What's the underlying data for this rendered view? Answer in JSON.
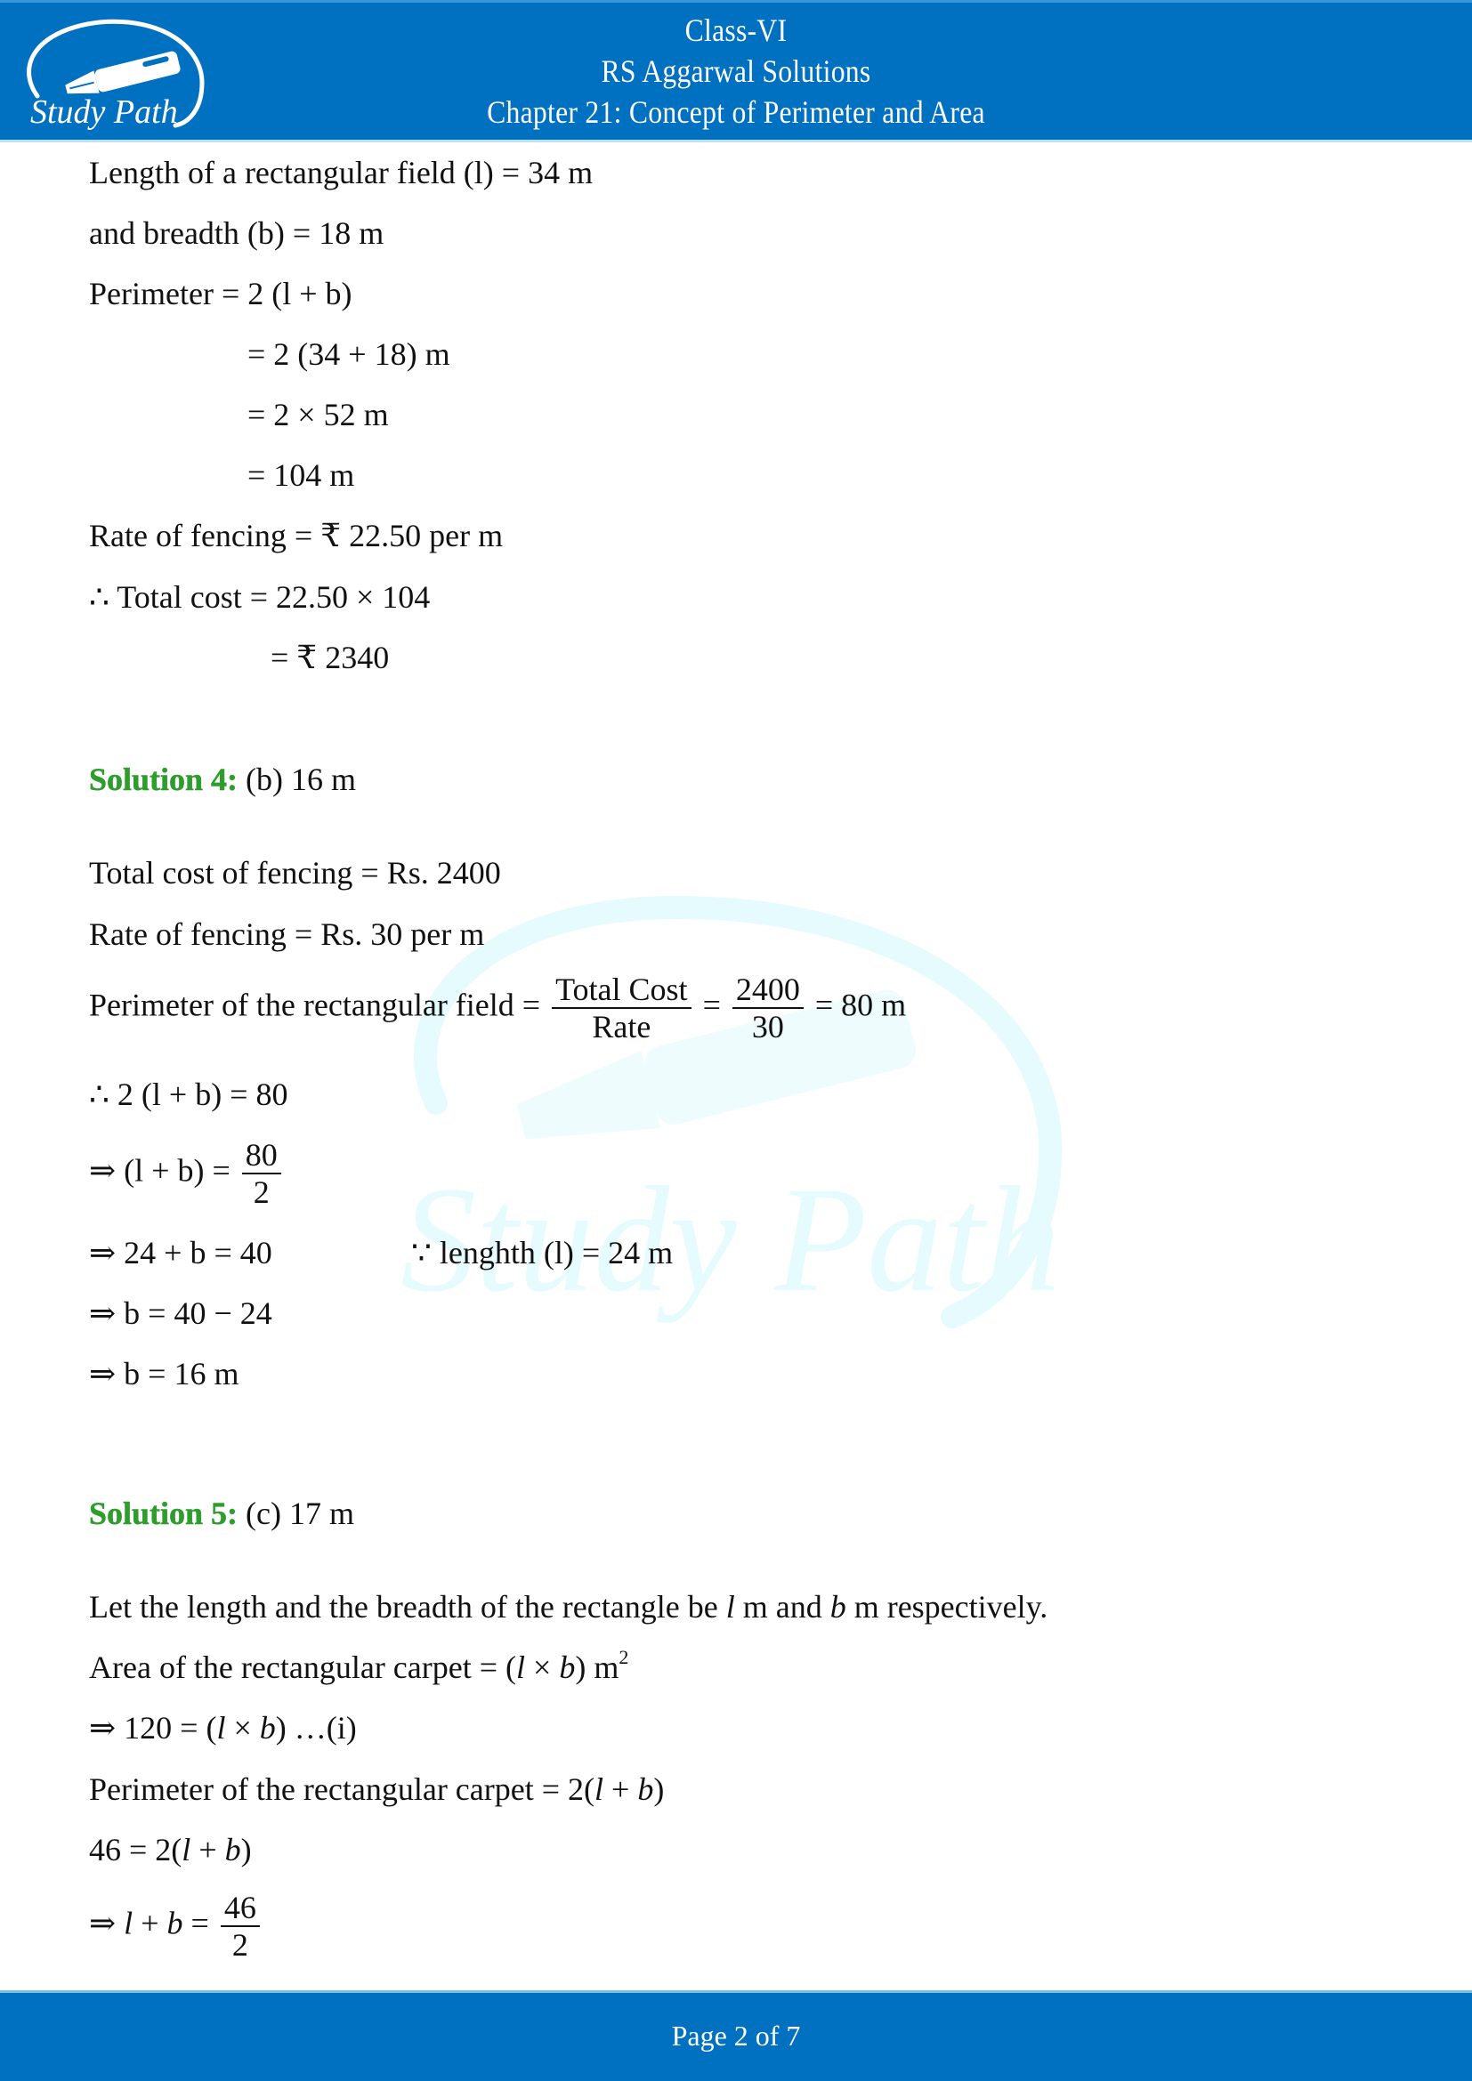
{
  "header": {
    "logo_text": "Study Path",
    "line1": "Class-VI",
    "line2": "RS Aggarwal Solutions",
    "line3": "Chapter 21: Concept of Perimeter and Area",
    "background_color": "#0070c0"
  },
  "solution3_cont": {
    "lines": [
      "Length of a rectangular field (l) = 34 m",
      "and breadth (b) = 18 m",
      "Perimeter = 2 (l + b)",
      "= 2 (34 + 18) m",
      "= 2 × 52 m",
      "= 104 m",
      "Rate of fencing = ₹ 22.50 per m",
      "∴ Total cost = 22.50 × 104",
      "= ₹ 2340"
    ]
  },
  "solution4": {
    "label": "Solution 4:",
    "answer": "(b) 16 m",
    "lines": [
      "Total cost of fencing = Rs. 2400",
      "Rate of fencing = Rs. 30 per m"
    ],
    "perimeter_eq": {
      "prefix": "Perimeter of the rectangular field =",
      "frac1_num": "Total Cost",
      "frac1_den": "Rate",
      "eq": "=",
      "frac2_num": "2400",
      "frac2_den": "30",
      "suffix": "= 80 m"
    },
    "step1": "∴ 2 (l + b) = 80",
    "step2_prefix": "⇒ (l + b) =",
    "step2_num": "80",
    "step2_den": "2",
    "step3": "⇒ 24 + b = 40",
    "step3_note": "∵ lenghth (l) = 24 m",
    "step4": "⇒ b = 40 − 24",
    "step5": "⇒ b = 16 m"
  },
  "solution5": {
    "label": "Solution 5:",
    "answer": "(c) 17 m",
    "intro_a": "Let the length and the breadth of the rectangle be ",
    "intro_l": "l",
    "intro_b_pre": " m and ",
    "intro_b": "b",
    "intro_end": "  m respectively.",
    "area_prefix": "Area of the rectangular carpet = (",
    "area_l": "l",
    "area_times": " × ",
    "area_b": "b",
    "area_end": ") m",
    "area_sup": "2",
    "eq1_prefix": "⇒ 120 = (",
    "eq1_l": "l",
    "eq1_times": " × ",
    "eq1_b": "b",
    "eq1_end": ")    …(i)",
    "perim_prefix": "Perimeter of the rectangular carpet = 2(",
    "perim_l": "l",
    "perim_plus": " + ",
    "perim_b": "b",
    "perim_end": ")",
    "eq2_prefix": "46 = 2(",
    "eq2_l": "l",
    "eq2_plus": " + ",
    "eq2_b": "b",
    "eq2_end": ")",
    "eq3_prefix": "⇒ ",
    "eq3_l": "l",
    "eq3_plus": " + ",
    "eq3_b": "b",
    "eq3_eq": " =",
    "eq3_num": "46",
    "eq3_den": "2"
  },
  "footer": {
    "page_text": "Page 2 of 7",
    "background_color": "#0070c0"
  },
  "watermark": {
    "text": "Study Path"
  }
}
